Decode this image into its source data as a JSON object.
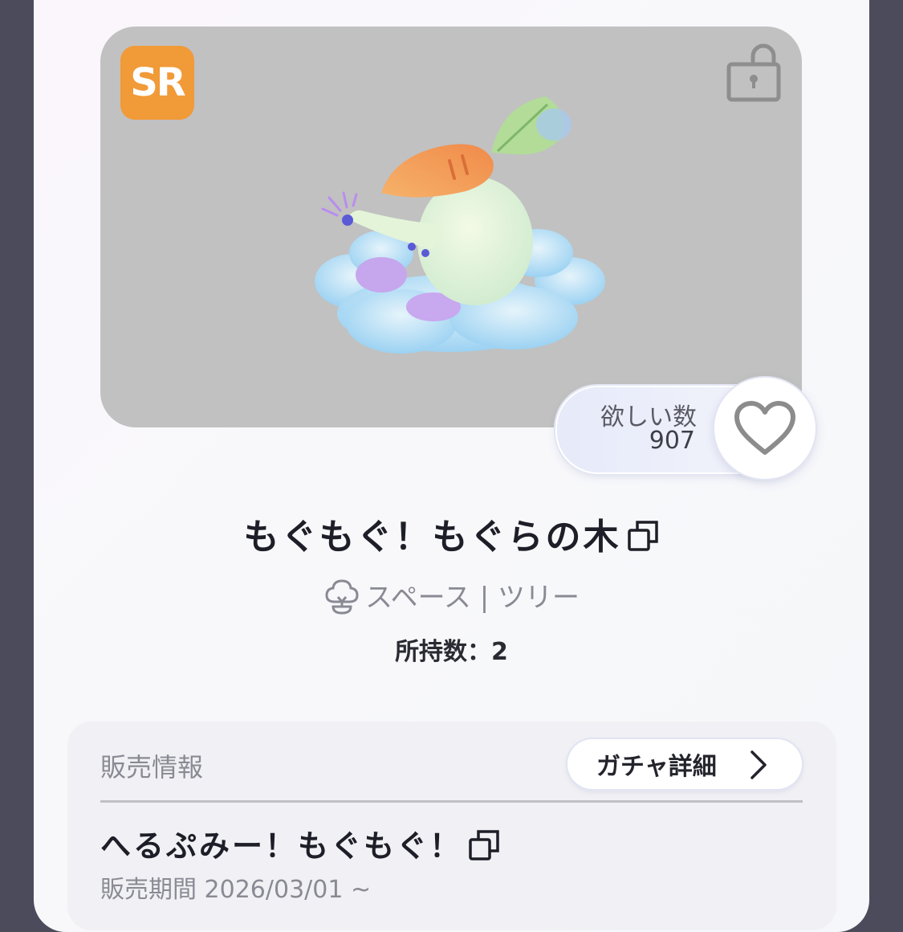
{
  "item": {
    "rarity": "SR",
    "title": "もぐもぐ！もぐらの木",
    "category": "スペース | ツリー",
    "owned": "所持数：2"
  },
  "wish": {
    "label": "欲しい数",
    "count": "907"
  },
  "sales": {
    "section_label": "販売情報",
    "gacha_button_label": "ガチャ詳細",
    "gacha_name": "へるぷみー！もぐもぐ！",
    "sale_period": "販売期間 2026/03/01 ~"
  },
  "icons": {
    "lock": "unlocked-padlock-icon",
    "heart": "heart-outline-icon",
    "copy": "copy-icon",
    "tree": "tree-icon",
    "chevron": "chevron-right-icon"
  },
  "colors": {
    "rarity_badge": "#f19a38",
    "preview_bg": "#c1c1c1",
    "page_bg": "#4b4b5c"
  }
}
